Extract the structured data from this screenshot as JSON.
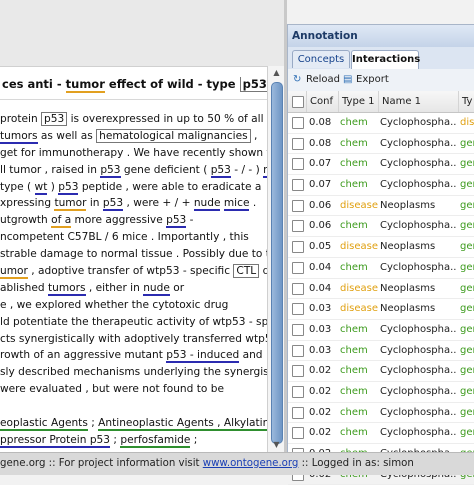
{
  "document": {
    "title_parts": [
      "ces anti - ",
      "tumor",
      " effect of wild - type ",
      "p53",
      " -"
    ],
    "lines": [
      [
        {
          "t": "protein "
        },
        {
          "t": "p53",
          "c": "boxed"
        },
        {
          "t": " is overexpressed in up to 50 % of all"
        }
      ],
      [
        {
          "t": "  "
        },
        {
          "t": "tumors",
          "c": "hl-blue"
        },
        {
          "t": " as well as "
        },
        {
          "t": "hematological malignancies",
          "c": "hl-orange boxed"
        },
        {
          "t": " ,"
        }
      ],
      [
        {
          "t": "get for immunotherapy . We have recently shown that"
        }
      ],
      [
        {
          "t": "ll tumor , raised in "
        },
        {
          "t": "p53",
          "c": "hl-blue"
        },
        {
          "t": " gene deficient ( "
        },
        {
          "t": "p53",
          "c": "hl-blue"
        },
        {
          "t": " - / - ) "
        },
        {
          "t": "mice",
          "c": "hl-blue"
        }
      ],
      [
        {
          "t": "type ( "
        },
        {
          "t": "wt",
          "c": "hl-blue"
        },
        {
          "t": " ) "
        },
        {
          "t": "p53",
          "c": "hl-blue"
        },
        {
          "t": " peptide , were able to eradicate a"
        }
      ],
      [
        {
          "t": "xpressing "
        },
        {
          "t": "tumor",
          "c": "hl-orange"
        },
        {
          "t": " in "
        },
        {
          "t": "p53",
          "c": "hl-blue"
        },
        {
          "t": " , were + / + "
        },
        {
          "t": "nude",
          "c": "hl-blue"
        },
        {
          "t": " "
        },
        {
          "t": "mice",
          "c": "hl-blue"
        },
        {
          "t": " ."
        }
      ],
      [
        {
          "t": "utgrowth "
        },
        {
          "t": "of a",
          "c": "hl-orange"
        },
        {
          "t": " more aggressive "
        },
        {
          "t": "p53",
          "c": "hl-blue"
        },
        {
          "t": " -"
        }
      ],
      [
        {
          "t": "ncompetent C57BL / 6 mice . Importantly , this"
        }
      ],
      [
        {
          "t": "strable damage to normal tissue . Possibly due to the"
        }
      ],
      [
        {
          "t": "umor",
          "c": "hl-orange"
        },
        {
          "t": " , adoptive transfer of wtp53 - specific "
        },
        {
          "t": "CTL",
          "c": "hl-blue boxed"
        },
        {
          "t": " did"
        }
      ],
      [
        {
          "t": "ablished "
        },
        {
          "t": "tumors",
          "c": "hl-blue"
        },
        {
          "t": " , either in "
        },
        {
          "t": "nude",
          "c": "hl-blue"
        },
        {
          "t": " or"
        }
      ],
      [
        {
          "t": "e , we explored whether the cytotoxic drug"
        }
      ],
      [
        {
          "t": "ld potentiate the therapeutic activity of wtp53 - specific"
        }
      ],
      [
        {
          "t": "cts synergistically with adoptively transferred wtp53 -"
        }
      ],
      [
        {
          "t": "rowth of an aggressive mutant "
        },
        {
          "t": "p53 - induced",
          "c": "hl-blue"
        },
        {
          "t": " and"
        }
      ],
      [
        {
          "t": "sly described mechanisms underlying the synergism"
        }
      ],
      [
        {
          "t": "were evaluated , but were not found to be"
        }
      ],
      [
        {
          "t": ""
        }
      ],
      [
        {
          "t": "eoplastic Agents",
          "c": "hl-green"
        },
        {
          "t": " ; "
        },
        {
          "t": "Antineoplastic Agents , Alkylating",
          "c": "hl-green"
        }
      ],
      [
        {
          "t": "ppressor Protein p53",
          "c": "hl-blue"
        },
        {
          "t": " ; "
        },
        {
          "t": "perfosfamide",
          "c": "hl-green"
        },
        {
          "t": " ;"
        }
      ],
      [
        {
          "t": " - beta",
          "c": "hl-blue"
        },
        {
          "t": " ; "
        },
        {
          "t": "ras Proteins",
          "c": "hl-blue"
        },
        {
          "t": " ; "
        },
        {
          "t": "Adjuvants , Immunologic",
          "c": "hl-blue"
        },
        {
          "t": " ;"
        }
      ],
      [
        {
          "t": "s ; Animals ; "
        },
        {
          "t": "Antineoplastic Agents",
          "c": "hl-green"
        },
        {
          "t": " ; pharmacology ;"
        }
      ]
    ]
  },
  "annotation": {
    "title": "Annotation",
    "tabs": [
      "Concepts",
      "Interactions"
    ],
    "toolbar": {
      "reload": "Reload",
      "export": "Export"
    },
    "columns": [
      "Conf",
      "Type 1",
      "Name 1",
      "Ty"
    ],
    "rows": [
      {
        "conf": "0.08",
        "type1": "chem",
        "name1": "Cyclophospha...",
        "type2": "dis"
      },
      {
        "conf": "0.08",
        "type1": "chem",
        "name1": "Cyclophospha...",
        "type2": "gen"
      },
      {
        "conf": "0.07",
        "type1": "chem",
        "name1": "Cyclophospha...",
        "type2": "gen"
      },
      {
        "conf": "0.07",
        "type1": "chem",
        "name1": "Cyclophospha...",
        "type2": "gen"
      },
      {
        "conf": "0.06",
        "type1": "disease",
        "name1": "Neoplasms",
        "type2": "gen"
      },
      {
        "conf": "0.06",
        "type1": "chem",
        "name1": "Cyclophospha...",
        "type2": "gen"
      },
      {
        "conf": "0.05",
        "type1": "disease",
        "name1": "Neoplasms",
        "type2": "gen"
      },
      {
        "conf": "0.04",
        "type1": "chem",
        "name1": "Cyclophospha...",
        "type2": "gen"
      },
      {
        "conf": "0.04",
        "type1": "disease",
        "name1": "Neoplasms",
        "type2": "gen"
      },
      {
        "conf": "0.03",
        "type1": "disease",
        "name1": "Neoplasms",
        "type2": "gen"
      },
      {
        "conf": "0.03",
        "type1": "chem",
        "name1": "Cyclophospha...",
        "type2": "gen"
      },
      {
        "conf": "0.03",
        "type1": "chem",
        "name1": "Cyclophospha...",
        "type2": "gen"
      },
      {
        "conf": "0.02",
        "type1": "chem",
        "name1": "Cyclophospha...",
        "type2": "gen"
      },
      {
        "conf": "0.02",
        "type1": "chem",
        "name1": "Cyclophospha...",
        "type2": "gen"
      },
      {
        "conf": "0.02",
        "type1": "chem",
        "name1": "Cyclophospha...",
        "type2": "gen"
      },
      {
        "conf": "0.02",
        "type1": "chem",
        "name1": "Cyclophospha...",
        "type2": "gen"
      },
      {
        "conf": "0.02",
        "type1": "chem",
        "name1": "Cyclophospha...",
        "type2": "gen"
      },
      {
        "conf": "0.02",
        "type1": "chem",
        "name1": "Cyclophospha...",
        "type2": "gen"
      }
    ]
  },
  "status": {
    "prefix": "gene.org",
    "sep1": " :: For project information visit ",
    "link": "www.ontogene.org",
    "suffix": " :: Logged in as: simon"
  },
  "colors": {
    "chem": "#3c9a1c",
    "disease": "#e0a010",
    "gene": "#3c9a1c",
    "dis": "#e0a010"
  },
  "icons": {
    "reload": "reload-icon",
    "export": "export-icon"
  }
}
